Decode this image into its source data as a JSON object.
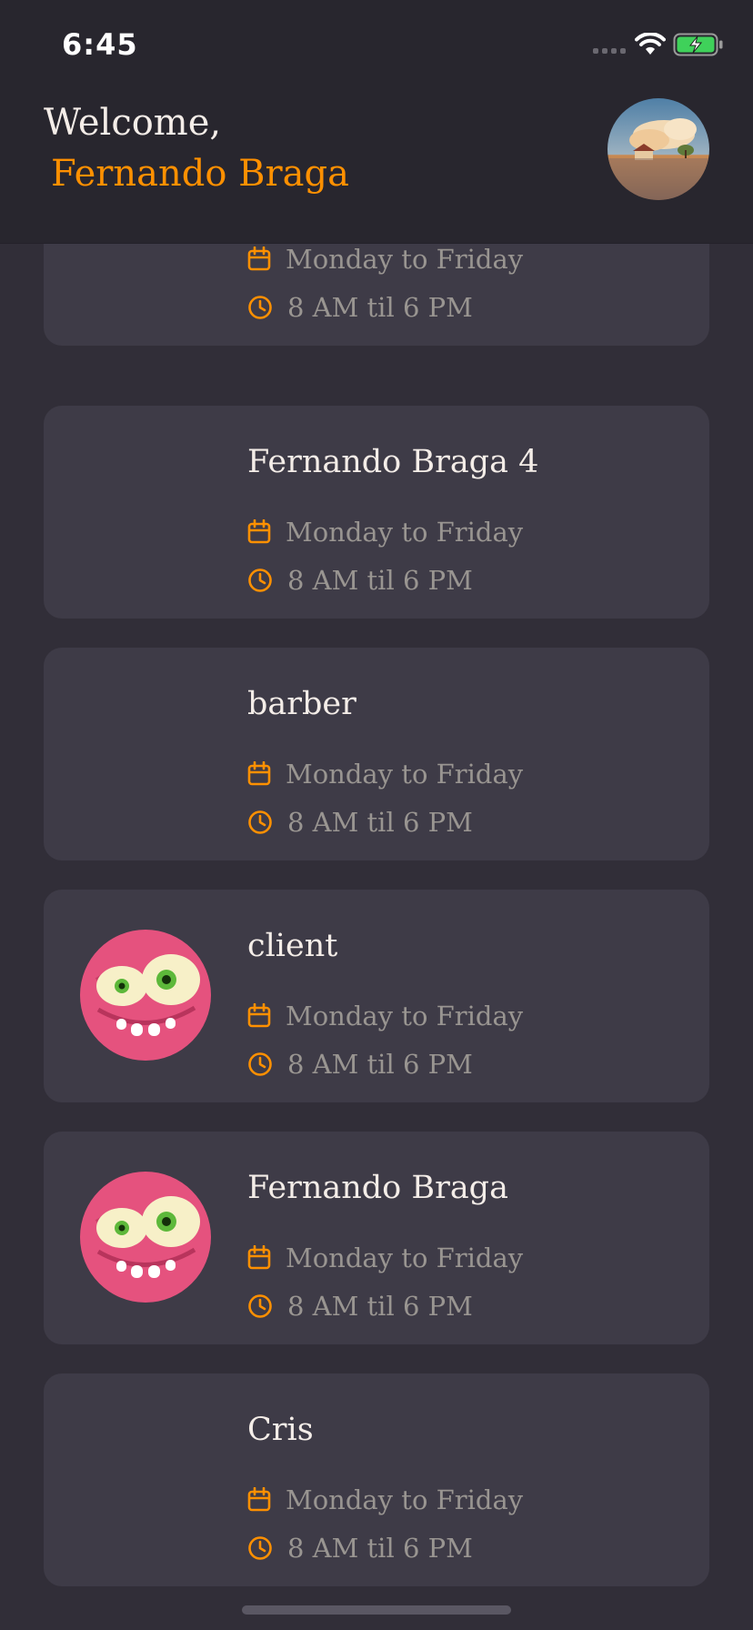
{
  "status": {
    "time": "6:45"
  },
  "header": {
    "greeting": "Welcome,",
    "user_name": "Fernando Braga"
  },
  "icons": {
    "calendar": "calendar-icon",
    "clock": "clock-icon",
    "accent": "#ff9000"
  },
  "providers": [
    {
      "name": "",
      "days": "Monday to Friday",
      "hours": "8 AM til 6 PM",
      "avatar": "none"
    },
    {
      "name": "Fernando Braga 4",
      "days": "Monday to Friday",
      "hours": "8 AM til 6 PM",
      "avatar": "none"
    },
    {
      "name": "barber",
      "days": "Monday to Friday",
      "hours": "8 AM til 6 PM",
      "avatar": "none"
    },
    {
      "name": "client",
      "days": "Monday to Friday",
      "hours": "8 AM til 6 PM",
      "avatar": "pink-monster"
    },
    {
      "name": "Fernando Braga",
      "days": "Monday to Friday",
      "hours": "8 AM til 6 PM",
      "avatar": "pink-monster"
    },
    {
      "name": "Cris",
      "days": "Monday to Friday",
      "hours": "8 AM til 6 PM",
      "avatar": "none"
    }
  ]
}
